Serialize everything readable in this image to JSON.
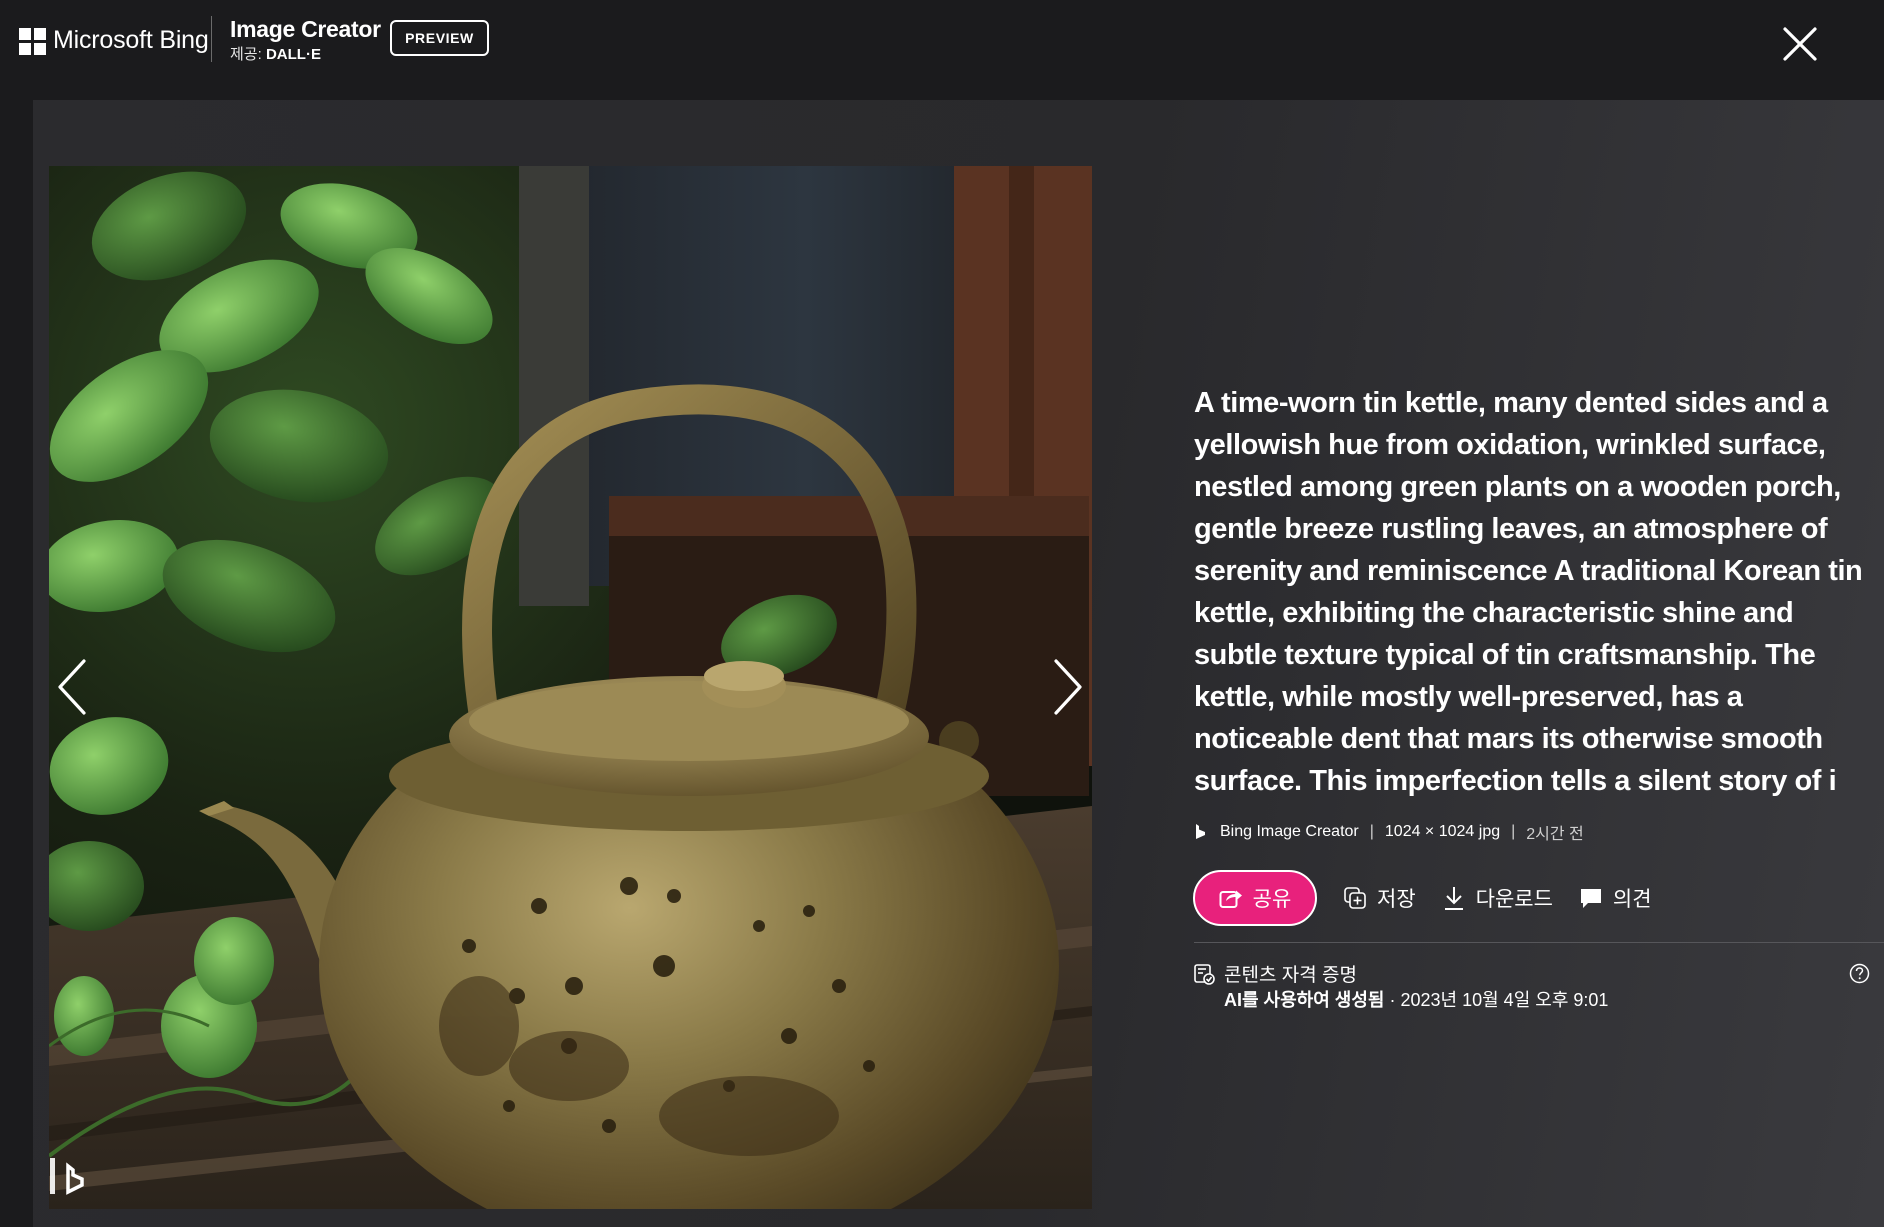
{
  "header": {
    "brand": "Microsoft Bing",
    "product_title": "Image Creator",
    "provider_prefix": "제공:",
    "provider_name": "DALL·E",
    "preview_label": "PREVIEW",
    "close_icon": "close-icon"
  },
  "viewer": {
    "image_alt": "dented tin kettle among green plants on a wooden porch",
    "prev_icon": "chevron-left-icon",
    "next_icon": "chevron-right-icon",
    "watermark_icon": "bing-watermark-icon"
  },
  "details": {
    "prompt": "A time-worn tin kettle, many dented sides and a yellowish hue from oxidation, wrinkled surface, nestled among green plants on a wooden porch, gentle breeze rustling leaves, an atmosphere of serenity and reminiscence A traditional Korean tin kettle, exhibiting the characteristic shine and subtle texture typical of tin craftsmanship. The kettle, while mostly well-preserved, has a noticeable dent that mars its otherwise smooth surface. This imperfection tells a silent story of i",
    "meta": {
      "source": "Bing Image Creator",
      "separator": "|",
      "size": "1024 × 1024 jpg",
      "time": "2시간 전"
    },
    "actions": {
      "share": "공유",
      "save": "저장",
      "download": "다운로드",
      "feedback": "의견"
    },
    "credentials": {
      "title": "콘텐츠 자격 증명",
      "ai_label": "AI를 사용하여 생성됨",
      "date": "· 2023년 10월 4일 오후 9:01"
    }
  },
  "colors": {
    "accent_share": "#e8217c",
    "background": "#1b1b1d"
  }
}
